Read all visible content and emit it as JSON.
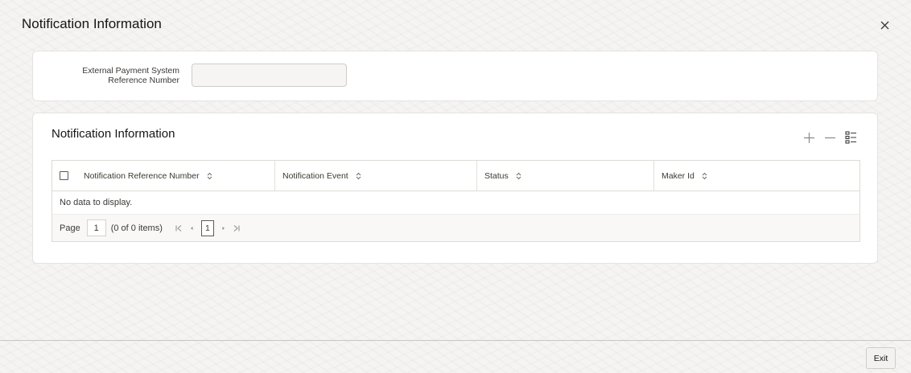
{
  "dialog": {
    "title": "Notification Information",
    "close_icon": "close-icon"
  },
  "criteria": {
    "reference_label": "External Payment System Reference Number",
    "reference_value": ""
  },
  "section": {
    "title": "Notification Information",
    "toolbar_icons": [
      "add-icon",
      "remove-icon",
      "column-chooser-icon"
    ]
  },
  "table": {
    "columns": [
      "Notification Reference Number",
      "Notification Event",
      "Status",
      "Maker Id"
    ],
    "rows": [],
    "empty_text": "No data to display."
  },
  "pagination": {
    "page_label": "Page",
    "page_value": "1",
    "items_text": "(0 of 0 items)",
    "current_page": "1"
  },
  "footer": {
    "exit_label": "Exit"
  },
  "colors": {
    "background": "#f5f4f2",
    "panel": "#ffffff",
    "text": "#161513"
  }
}
